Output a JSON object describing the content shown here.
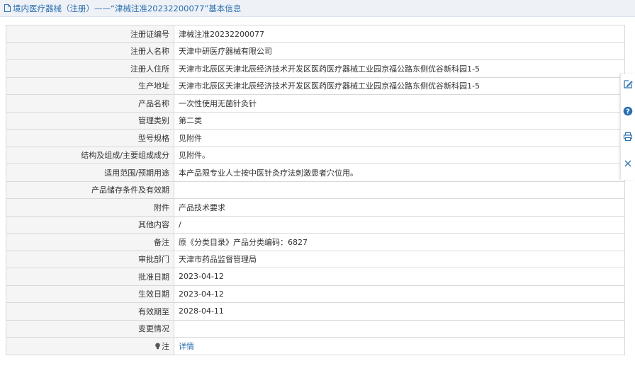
{
  "header": {
    "title": "境内医疗器械（注册）——“津械注准20232200077”基本信息"
  },
  "rows": [
    {
      "label": "注册证编号",
      "value": "津械注准20232200077"
    },
    {
      "label": "注册人名称",
      "value": "天津中研医疗器械有限公司"
    },
    {
      "label": "注册人住所",
      "value": "天津市北辰区天津北辰经济技术开发区医药医疗器械工业园京福公路东侧优谷新科园1-5"
    },
    {
      "label": "生产地址",
      "value": "天津市北辰区天津北辰经济技术开发区医药医疗器械工业园京福公路东侧优谷新科园1-5"
    },
    {
      "label": "产品名称",
      "value": "一次性使用无菌针灸针"
    },
    {
      "label": "管理类别",
      "value": "第二类"
    },
    {
      "label": "型号规格",
      "value": "见附件"
    },
    {
      "label": "结构及组成/主要组成成分",
      "value": "见附件。"
    },
    {
      "label": "适用范围/预期用途",
      "value": "本产品限专业人士按中医针灸疗法刺激患者穴位用。"
    },
    {
      "label": "产品储存条件及有效期",
      "value": ""
    },
    {
      "label": "附件",
      "value": "产品技术要求"
    },
    {
      "label": "其他内容",
      "value": "/"
    },
    {
      "label": "备注",
      "value": "原《分类目录》产品分类编码：6827"
    },
    {
      "label": "审批部门",
      "value": "天津市药品监督管理局"
    },
    {
      "label": "批准日期",
      "value": "2023-04-12"
    },
    {
      "label": "生效日期",
      "value": "2023-04-12"
    },
    {
      "label": "有效期至",
      "value": "2028-04-11"
    },
    {
      "label": "变更情况",
      "value": ""
    }
  ],
  "note_row": {
    "label": "注",
    "link": "详情"
  },
  "sidebar": {
    "icons": [
      "edit-icon",
      "help-icon",
      "print-icon",
      "close-icon"
    ]
  },
  "colors": {
    "accent": "#2a6fb0",
    "label_bg": "#f5f5f5",
    "border": "#d9d9d9"
  }
}
